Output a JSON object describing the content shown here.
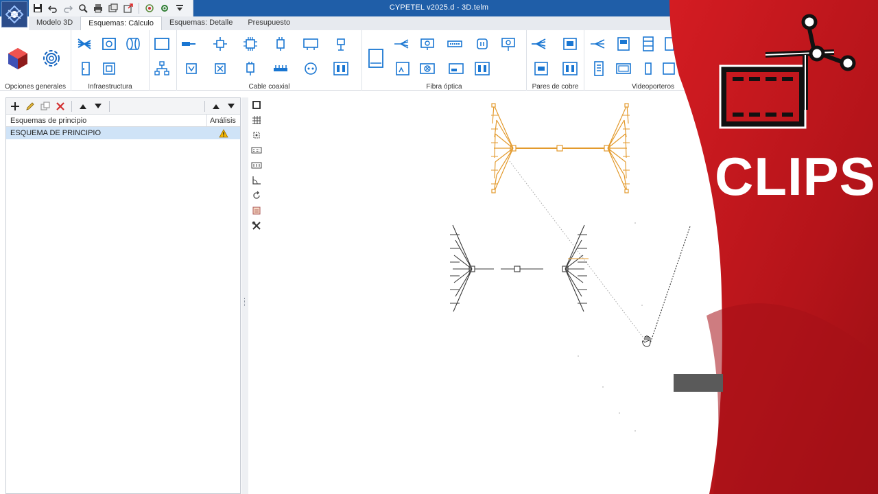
{
  "window": {
    "title": "CYPETEL v2025.d - 3D.telm"
  },
  "quick_access": {
    "icons": [
      "save-icon",
      "undo-icon",
      "redo-icon",
      "zoom-icon",
      "print-icon",
      "view-icon",
      "export-icon",
      "update-icon",
      "settings-icon",
      "dropdown-icon"
    ]
  },
  "tabs": [
    {
      "label": "Modelo 3D",
      "active": false
    },
    {
      "label": "Esquemas: Cálculo",
      "active": true
    },
    {
      "label": "Esquemas: Detalle",
      "active": false
    },
    {
      "label": "Presupuesto",
      "active": false
    }
  ],
  "ribbon": {
    "groups": [
      {
        "label": "Opciones generales"
      },
      {
        "label": "Infraestructura"
      },
      {
        "label": "Cable coaxial"
      },
      {
        "label": "Fibra óptica"
      },
      {
        "label": "Pares de cobre"
      },
      {
        "label": "Videoporteros"
      }
    ]
  },
  "left_panel": {
    "columns": {
      "name": "Esquemas de principio",
      "analysis": "Análisis"
    },
    "rows": [
      {
        "name": "ESQUEMA DE PRINCIPIO",
        "status": "warning"
      }
    ]
  },
  "overlay": {
    "brand_text": "CLIPS",
    "brand_color": "#c8141b"
  },
  "colors": {
    "title_bar": "#1f5ea8",
    "selected_diagram": "#e39a2d",
    "diagram": "#3a3a3a"
  }
}
